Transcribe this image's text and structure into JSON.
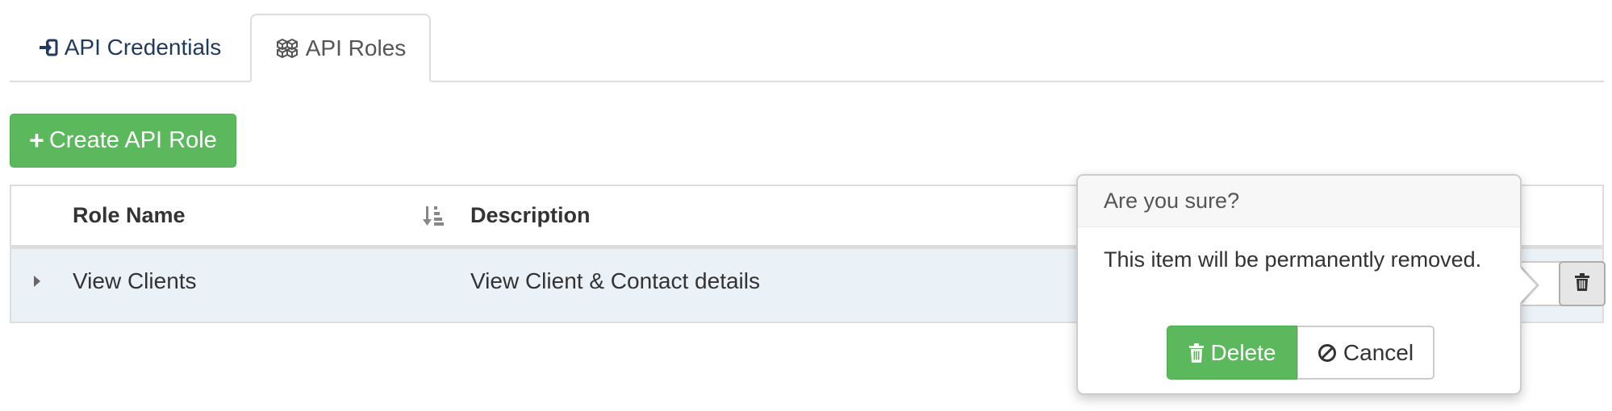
{
  "tabs": [
    {
      "label": "API Credentials",
      "icon": "sign-in-icon"
    },
    {
      "label": "API Roles",
      "icon": "cubes-icon"
    }
  ],
  "toolbar": {
    "create_label": "Create API Role"
  },
  "table": {
    "columns": [
      "Role Name",
      "Description"
    ],
    "rows": [
      {
        "role_name": "View Clients",
        "description": "View Client & Contact details"
      }
    ]
  },
  "popover": {
    "title": "Are you sure?",
    "body": "This item will be permanently removed.",
    "delete_label": "Delete",
    "cancel_label": "Cancel"
  },
  "colors": {
    "success": "#5cb85c",
    "row_highlight": "#eaf1f7",
    "tab_text": "#1f3a5f"
  }
}
